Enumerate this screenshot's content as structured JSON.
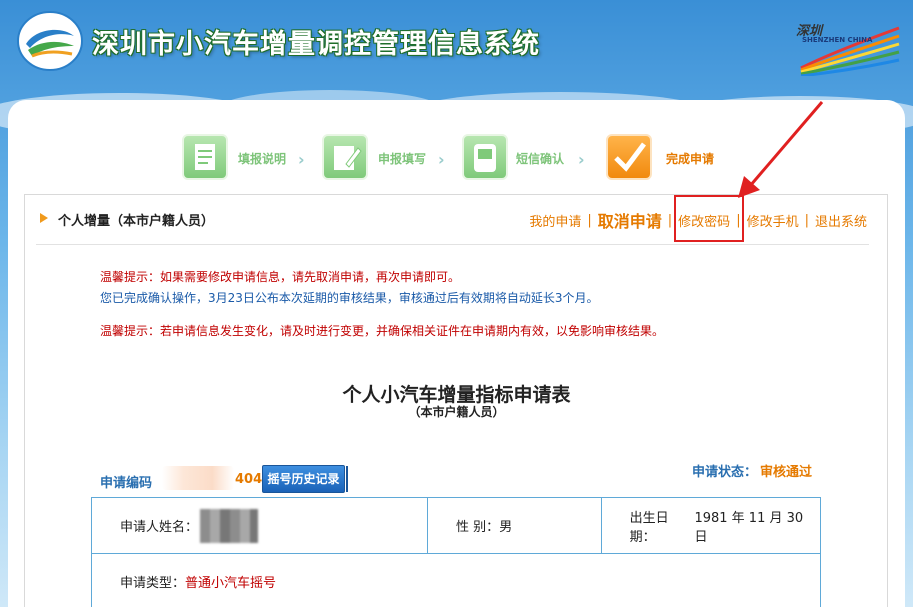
{
  "header": {
    "site_title": "深圳市小汽车增量调控管理信息系统",
    "brand_cn": "深圳",
    "brand_en": "SHENZHEN CHINA"
  },
  "steps": [
    {
      "label": "填报说明",
      "status": "done-past"
    },
    {
      "label": "申报填写",
      "status": "done-past"
    },
    {
      "label": "短信确认",
      "status": "done-past"
    },
    {
      "label": "完成申请",
      "status": "current"
    }
  ],
  "breadcrumb": "个人增量（本市户籍人员）",
  "top_links": {
    "my_application": "我的申请",
    "cancel_application": "取消申请",
    "change_password": "修改密码",
    "change_phone": "修改手机",
    "logout": "退出系统",
    "separator": "|"
  },
  "notices": {
    "tip1": "温馨提示：如果需要修改申请信息，请先取消申请，再次申请即可。",
    "info": "您已完成确认操作，3月23日公布本次延期的审核结果，审核通过后有效期将自动延长3个月。",
    "tip2": "温馨提示：若申请信息发生变化，请及时进行变更，并确保相关证件在申请期内有效，以免影响审核结果。"
  },
  "form": {
    "title": "个人小汽车增量指标申请表",
    "subtitle": "（本市户籍人员）",
    "application_no_label": "申请编码",
    "application_no_visible": "404",
    "history_button": "摇号历史记录",
    "status_label": "申请状态：",
    "status_value": "审核通过"
  },
  "applicant": {
    "name_label": "申请人姓名：",
    "gender_label": "性  别：",
    "gender_value": "男",
    "birth_label": "出生日期：",
    "birth_value": "1981 年 11 月 30 日",
    "type_label": "申请类型：",
    "type_value": "普通小汽车摇号"
  },
  "colors": {
    "accent_orange": "#e57a00",
    "notice_red": "#c00000",
    "label_blue": "#2a6fb0",
    "table_border": "#5fa9d8",
    "annotation_red": "#e02020"
  }
}
